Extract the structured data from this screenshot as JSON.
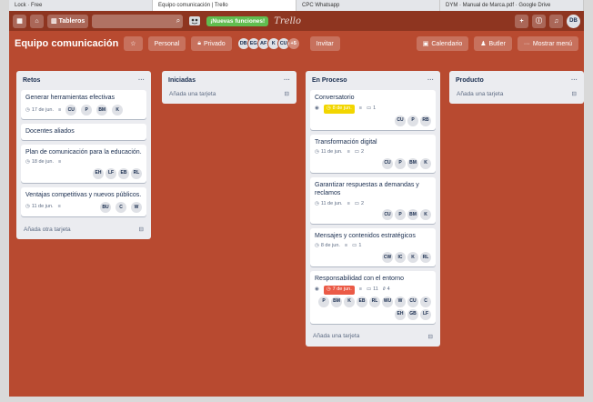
{
  "browser_tabs": [
    "Lock · Free",
    "Equipo comunicación | Trello",
    "CPC Whatsapp",
    "DYM · Manual de Marca.pdf · Google Drive"
  ],
  "header": {
    "board_button": "Tableros",
    "new_features": "¡Nuevas funciones!",
    "brand": "Trello",
    "user_initials": "DB"
  },
  "board": {
    "title": "Equipo comunicación",
    "visibility_team": "Personal",
    "visibility": "Privado",
    "members": [
      "DB",
      "EG",
      "AF",
      "K",
      "CU"
    ],
    "members_more": "+5",
    "invite": "Invitar",
    "calendar": "Calendario",
    "butler": "Butler",
    "menu": "Mostrar menú"
  },
  "lists": [
    {
      "title": "Retos",
      "cards": [
        {
          "title": "Generar herramientas efectivas",
          "due": "17 de jun.",
          "members": [
            "CU",
            "P",
            "BM",
            "K"
          ],
          "desc": true
        },
        {
          "title": "Docentes aliados"
        },
        {
          "title": "Plan de comunicación para la educación.",
          "due": "18 de jun.",
          "desc": true,
          "members": [
            "EH",
            "LF",
            "EB",
            "RL"
          ]
        },
        {
          "title": "Ventajas competitivas y nuevos públicos.",
          "due": "11 de jun.",
          "desc": true,
          "members": [
            "BU",
            "C",
            "W"
          ]
        }
      ],
      "add_label": "Añada otra tarjeta"
    },
    {
      "title": "Iniciadas",
      "cards": [],
      "add_label": "Añada una tarjeta"
    },
    {
      "title": "En Proceso",
      "cards": [
        {
          "title": "Conversatorio",
          "watch": true,
          "due_yellow": "8 de jun.",
          "desc": true,
          "comments": "1",
          "members": [
            "CU",
            "P",
            "RB"
          ]
        },
        {
          "title": "Transformación digital",
          "due": "11 de jun.",
          "desc": true,
          "comments": "2",
          "members": [
            "CU",
            "P",
            "BM",
            "K"
          ]
        },
        {
          "title": "Garantizar respuestas a demandas y reclamos",
          "due": "11 de jun.",
          "desc": true,
          "comments": "2",
          "members": [
            "CU",
            "P",
            "BM",
            "K"
          ]
        },
        {
          "title": "Mensajes y contenidos estratégicos",
          "due": "8 de jun.",
          "desc": true,
          "comments": "1",
          "members": [
            "CW",
            "IC",
            "K",
            "RL"
          ]
        },
        {
          "title": "Responsabilidad con el entorno",
          "watch": true,
          "due_red": "7 de jun.",
          "desc": true,
          "comments": "11",
          "attachments": "4",
          "members": [
            "P",
            "BM",
            "K",
            "EB",
            "RL",
            "WU",
            "W",
            "CU",
            "C",
            "EH",
            "GB",
            "LF"
          ]
        }
      ],
      "add_label": "Añada una tarjeta"
    },
    {
      "title": "Producto",
      "cards": [],
      "add_label": "Añada una tarjeta"
    }
  ],
  "colors": {
    "board_bg": "#b84a30",
    "header_bg": "#8e3520",
    "list_bg": "#ebecf0",
    "due_soon": "#f2d600",
    "overdue": "#eb5a46",
    "new_features": "#61bd4f"
  }
}
